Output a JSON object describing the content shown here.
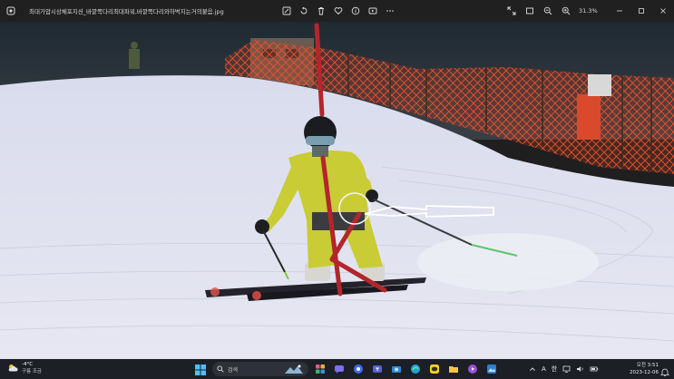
{
  "window": {
    "filename": "최대가압시상체포지션_바깥쪽다리최대파워,바깥쪽다리와하벅지는거의붙음.jpg",
    "zoom": "31.3%"
  },
  "toolbar": {
    "icons": [
      "edit-image-icon",
      "rotate-icon",
      "delete-icon",
      "favorite-icon",
      "info-icon",
      "slideshow-icon",
      "more-icon"
    ],
    "right_icons": [
      "fullscreen-icon",
      "fit-window-icon",
      "zoom-out-icon",
      "zoom-in-icon"
    ]
  },
  "taskbar": {
    "weather": {
      "temp": "-4°C",
      "desc": "구름 조금"
    },
    "search_label": "검색",
    "tray": {
      "ime_a": "A",
      "ime_han": "한"
    },
    "clock": {
      "time": "오전 3:51",
      "date": "2023-12-06"
    }
  },
  "colors": {
    "titlebar_bg": "#202020",
    "taskbar_bg": "#1c1f26",
    "annotation_red": "#b3262b",
    "fence_orange": "#e8542a",
    "jacket_yellow": "#c9cc35"
  }
}
